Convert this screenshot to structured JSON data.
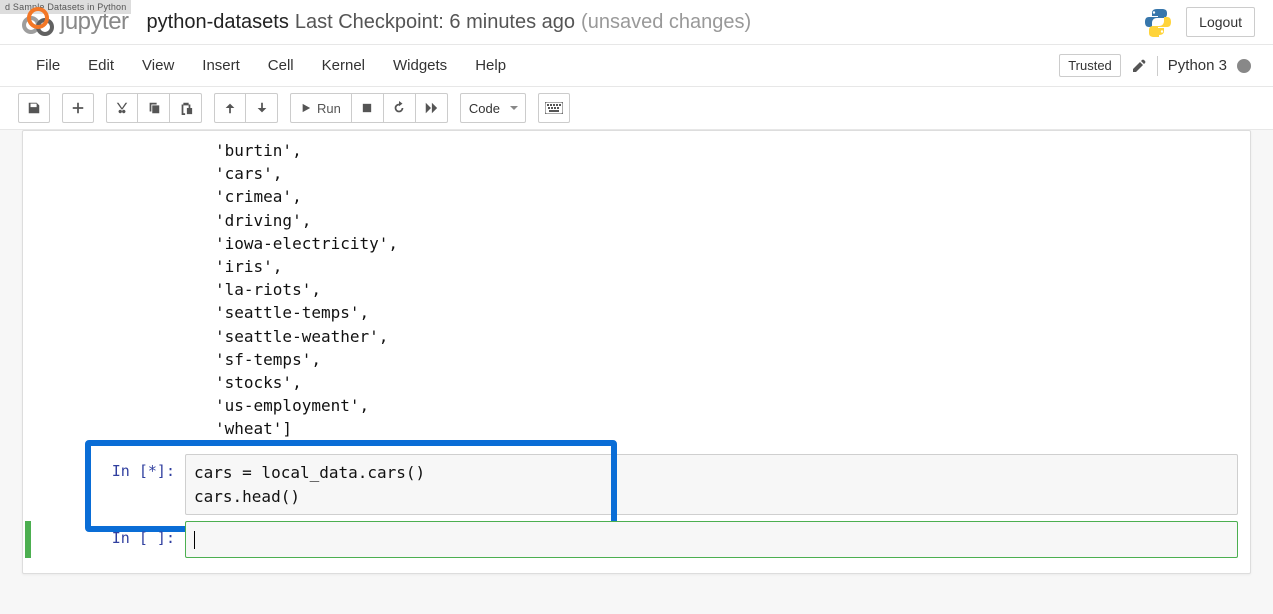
{
  "browser_tab": "d Sample Datasets in Python",
  "header": {
    "logo_text": "jupyter",
    "notebook_title": "python-datasets",
    "checkpoint": "Last Checkpoint: 6 minutes ago",
    "unsaved": "(unsaved changes)",
    "logout_label": "Logout"
  },
  "menubar": {
    "items": [
      "File",
      "Edit",
      "View",
      "Insert",
      "Cell",
      "Kernel",
      "Widgets",
      "Help"
    ],
    "trusted_label": "Trusted",
    "kernel_name": "Python 3"
  },
  "toolbar": {
    "run_label": "Run",
    "cell_type_selected": "Code",
    "icons": {
      "save": "save-icon",
      "add": "plus-icon",
      "cut": "scissors-icon",
      "copy": "copy-icon",
      "paste": "paste-icon",
      "up": "arrow-up-icon",
      "down": "arrow-down-icon",
      "run": "play-icon",
      "stop": "stop-icon",
      "restart": "refresh-icon",
      "restart_run": "fast-forward-icon",
      "command_palette": "keyboard-icon"
    }
  },
  "output_lines": [
    "'burtin',",
    "'cars',",
    "'crimea',",
    "'driving',",
    "'iowa-electricity',",
    "'iris',",
    "'la-riots',",
    "'seattle-temps',",
    "'seattle-weather',",
    "'sf-temps',",
    "'stocks',",
    "'us-employment',",
    "'wheat']"
  ],
  "cells": [
    {
      "prompt": "In [*]:",
      "code": "cars = local_data.cars()\ncars.head()"
    },
    {
      "prompt": "In [ ]:",
      "code": ""
    }
  ]
}
